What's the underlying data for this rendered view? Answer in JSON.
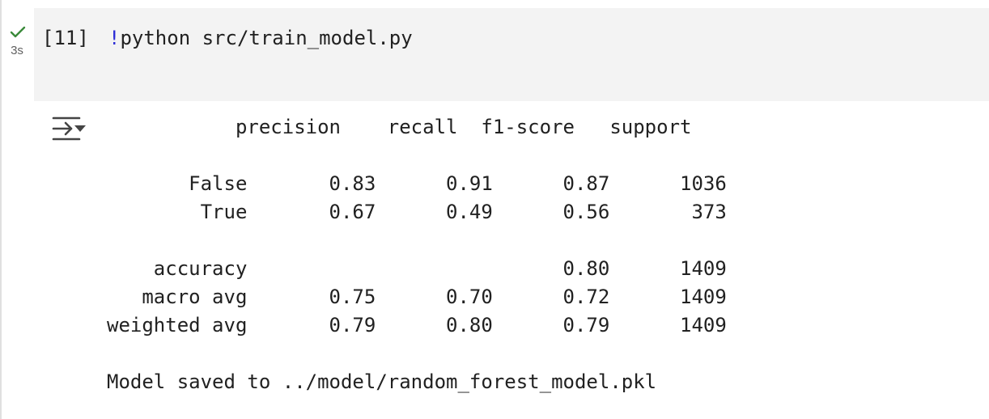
{
  "cell": {
    "status_icon": "check-icon",
    "exec_time": "3s",
    "exec_count": "[11]",
    "code_bang": "!",
    "code_rest": "python src/train_model.py"
  },
  "output": {
    "toggle_icon": "output-toggle-icon",
    "lines": [
      "           precision    recall  f1-score   support",
      "",
      "       False       0.83      0.91      0.87      1036",
      "        True       0.67      0.49      0.56       373",
      "",
      "    accuracy                           0.80      1409",
      "   macro avg       0.75      0.70      0.72      1409",
      "weighted avg       0.79      0.80      0.79      1409",
      "",
      "Model saved to ../model/random_forest_model.pkl"
    ]
  }
}
